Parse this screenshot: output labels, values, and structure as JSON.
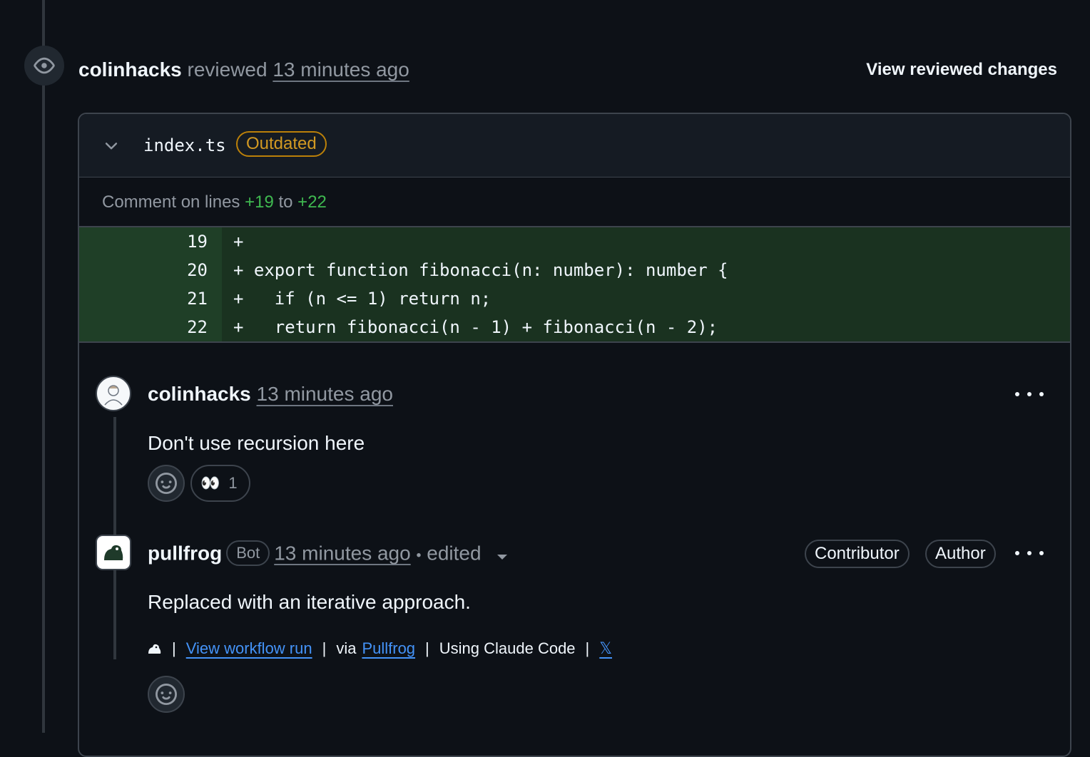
{
  "review": {
    "author": "colinhacks",
    "action": "reviewed",
    "time": "13 minutes ago",
    "view_changes_label": "View reviewed changes"
  },
  "file": {
    "name": "index.ts",
    "status_badge": "Outdated",
    "comment_on_prefix": "Comment on lines",
    "line_start": "+19",
    "line_to": "to",
    "line_end": "+22"
  },
  "diff": {
    "lines": [
      {
        "num": "19",
        "code": "+"
      },
      {
        "num": "20",
        "code": "+ export function fibonacci(n: number): number {"
      },
      {
        "num": "21",
        "code": "+   if (n <= 1) return n;"
      },
      {
        "num": "22",
        "code": "+   return fibonacci(n - 1) + fibonacci(n - 2);"
      }
    ]
  },
  "comments": [
    {
      "author": "colinhacks",
      "time": "13 minutes ago",
      "body": "Don't use recursion here",
      "reactions": [
        {
          "emoji": "👀",
          "count": "1"
        }
      ]
    },
    {
      "author": "pullfrog",
      "bot_badge": "Bot",
      "time": "13 minutes ago",
      "edited_label": "edited",
      "roles": [
        "Contributor",
        "Author"
      ],
      "body": "Replaced with an iterative approach.",
      "footer": {
        "view_run": "View workflow run",
        "via": "via",
        "pullfrog_link": "Pullfrog",
        "using": "Using Claude Code",
        "x_link": "𝕏",
        "sep": "|"
      }
    }
  ],
  "colors": {
    "background": "#0d1117",
    "border": "#3d444d",
    "add_green": "#3fb950",
    "diff_bg": "#1a3220",
    "outdated": "#d29922",
    "link": "#4493f8"
  }
}
